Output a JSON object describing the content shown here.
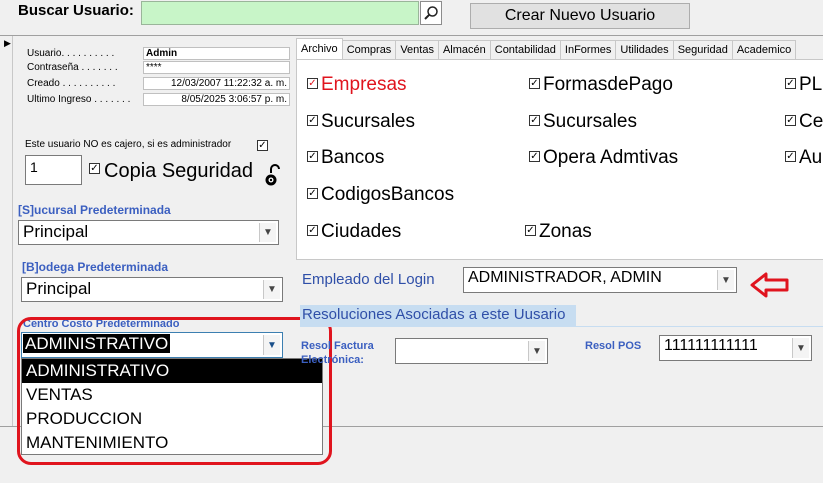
{
  "top": {
    "search_label": "Buscar Usuario:",
    "search_value": "",
    "create_button": "Crear Nuevo Usuario"
  },
  "user_info": {
    "rows": [
      {
        "label": "Usuario. . . . . . . . . .",
        "value": "Admin"
      },
      {
        "label": "Contraseña . . . . . . .",
        "value": "****"
      },
      {
        "label": "Creado . . . . . . . . . .",
        "value": "12/03/2007 11:22:32 a. m."
      },
      {
        "label": "Ultimo Ingreso . . . . . . .",
        "value": "8/05/2025 3:06:57 p. m."
      }
    ]
  },
  "cajero": {
    "label": "Este usuario NO es cajero, si es administrador",
    "checked_mark": "✓",
    "number_value": "1",
    "copia_label": "Copia Seguridad"
  },
  "sucursal": {
    "label": "[S]ucursal Predeterminada",
    "value": "Principal"
  },
  "bodega": {
    "label": "[B]odega Predeterminada",
    "value": "Principal"
  },
  "centro_costo": {
    "label": "Centro Costo Predeterminado",
    "value": "ADMINISTRATIVO",
    "options": [
      "ADMINISTRATIVO",
      "VENTAS",
      "PRODUCCION",
      "MANTENIMIENTO"
    ]
  },
  "tabs": [
    "Archivo",
    "Compras",
    "Ventas",
    "Almacén",
    "Contabilidad",
    "InFormes",
    "Utilidades",
    "Seguridad",
    "Academico"
  ],
  "permissions": {
    "col1": [
      "Empresas",
      "Sucursales",
      "Bancos",
      "CodigosBancos",
      "Ciudades"
    ],
    "col2": [
      "FormasdePago",
      "Sucursales",
      "Opera Admtivas",
      "Zonas"
    ],
    "col3": [
      "PL",
      "Ce",
      "Au"
    ],
    "highlight_color": "#e0141e"
  },
  "empleado": {
    "label": "Empleado del Login",
    "value": "ADMINISTRADOR, ADMIN"
  },
  "resoluciones": {
    "header": "Resoluciones Asociadas a este Uusario",
    "fe_label_line1": "Resol Factura",
    "fe_label_line2": "Electrónica:",
    "fe_value": "",
    "pos_label": "Resol POS",
    "pos_value": "111111111111"
  }
}
